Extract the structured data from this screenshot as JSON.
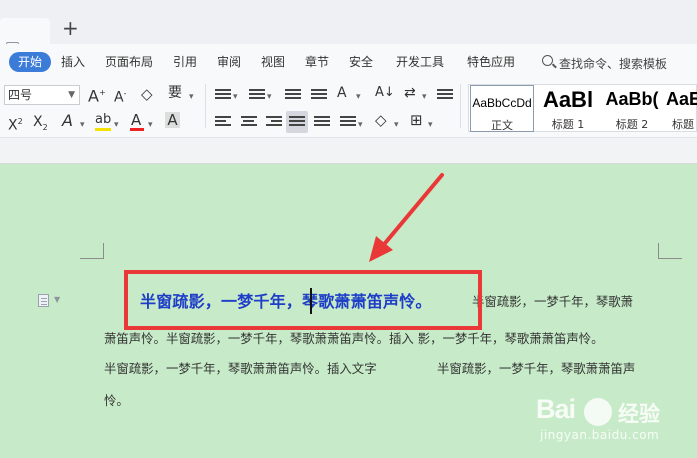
{
  "tabs": {
    "plus_label": "+"
  },
  "menu": {
    "active": "开始",
    "items": [
      "插入",
      "页面布局",
      "引用",
      "审阅",
      "视图",
      "章节",
      "安全",
      "开发工具",
      "特色应用"
    ],
    "search": "查找命令、搜索模板"
  },
  "toolbar": {
    "font_size": "四号",
    "pinyin_glyph": "要",
    "styles": [
      {
        "sample": "AaBbCcDd",
        "name": "正文"
      },
      {
        "sample": "AaBl",
        "name": "标题 1"
      },
      {
        "sample": "AaBb(",
        "name": "标题 2"
      },
      {
        "sample": "AaE",
        "name": "标题"
      }
    ]
  },
  "document": {
    "heading": "半窗疏影，一梦千年，琴歌萧萧笛声怜。",
    "line1": "半窗疏影，一梦千年，琴歌萧",
    "line2": "萧笛声怜。半窗疏影，一梦千年，琴歌萧萧笛声怜。插入 影，一梦千年，琴歌萧萧笛声怜。",
    "line3": "半窗疏影，一梦千年，琴歌萧萧笛声怜。插入文字",
    "line3b": "半窗疏影，一梦千年，琴歌萧萧笛声",
    "line4": "怜。"
  },
  "watermark": {
    "brand": "Bai",
    "brand_suffix": "经验",
    "url": "jingyan.baidu.com"
  },
  "colors": {
    "accent": "#3c7cd9",
    "highlight": "#ea3737",
    "heading": "#1f3ec7",
    "page": "#c7ebc8"
  }
}
